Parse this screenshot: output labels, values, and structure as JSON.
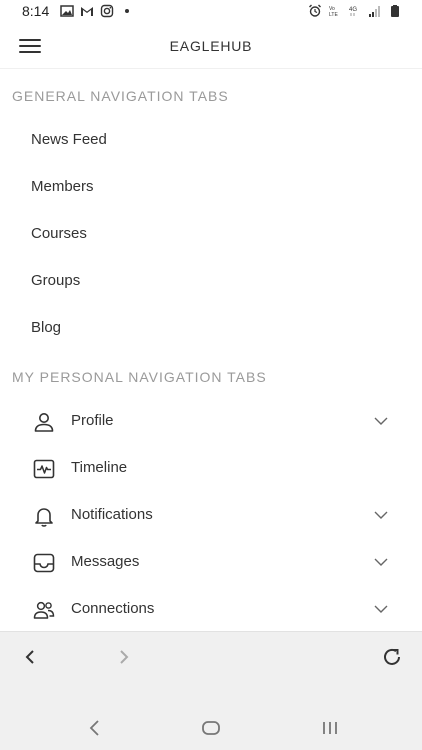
{
  "status_bar": {
    "time": "8:14",
    "left_icons": [
      "image-icon",
      "gmail-icon",
      "instagram-icon",
      "dot-icon"
    ],
    "right_icons": [
      "alarm-icon",
      "volte-icon",
      "4g-icon",
      "signal-icon",
      "battery-icon"
    ]
  },
  "header": {
    "title": "EAGLEHUB"
  },
  "general": {
    "title": "GENERAL NAVIGATION TABS",
    "items": [
      {
        "label": "News Feed"
      },
      {
        "label": "Members"
      },
      {
        "label": "Courses"
      },
      {
        "label": "Groups"
      },
      {
        "label": "Blog"
      }
    ]
  },
  "personal": {
    "title": "MY PERSONAL NAVIGATION TABS",
    "items": [
      {
        "label": "Profile",
        "icon": "user-icon",
        "has_chevron": true
      },
      {
        "label": "Timeline",
        "icon": "activity-icon",
        "has_chevron": false
      },
      {
        "label": "Notifications",
        "icon": "bell-icon",
        "has_chevron": true
      },
      {
        "label": "Messages",
        "icon": "inbox-icon",
        "has_chevron": true
      },
      {
        "label": "Connections",
        "icon": "users-icon",
        "has_chevron": true
      }
    ]
  },
  "browser_bar": {
    "icons": [
      "back-arrow-icon",
      "forward-arrow-icon",
      "refresh-icon"
    ]
  },
  "system_nav": {
    "icons": [
      "system-back-icon",
      "home-icon",
      "recents-icon"
    ]
  },
  "colors": {
    "text": "#333333",
    "section_title": "#9a9a9a",
    "bar_bg": "#f0f0f0"
  }
}
